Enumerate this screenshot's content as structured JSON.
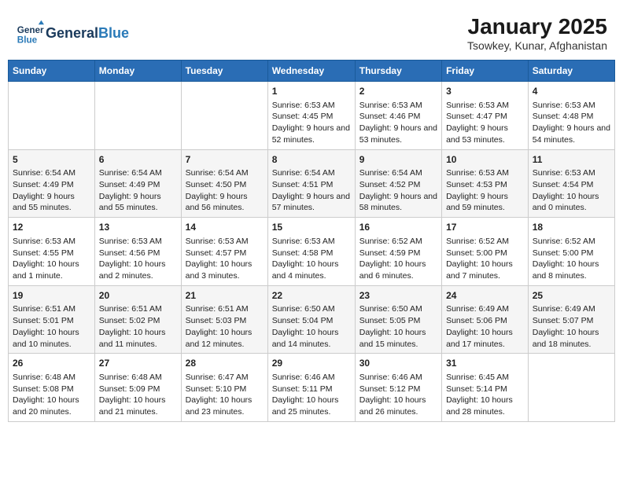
{
  "header": {
    "logo_general": "General",
    "logo_blue": "Blue",
    "title": "January 2025",
    "subtitle": "Tsowkey, Kunar, Afghanistan"
  },
  "days": [
    "Sunday",
    "Monday",
    "Tuesday",
    "Wednesday",
    "Thursday",
    "Friday",
    "Saturday"
  ],
  "weeks": [
    [
      {
        "date": "",
        "content": ""
      },
      {
        "date": "",
        "content": ""
      },
      {
        "date": "",
        "content": ""
      },
      {
        "date": "1",
        "content": "Sunrise: 6:53 AM\nSunset: 4:45 PM\nDaylight: 9 hours and 52 minutes."
      },
      {
        "date": "2",
        "content": "Sunrise: 6:53 AM\nSunset: 4:46 PM\nDaylight: 9 hours and 53 minutes."
      },
      {
        "date": "3",
        "content": "Sunrise: 6:53 AM\nSunset: 4:47 PM\nDaylight: 9 hours and 53 minutes."
      },
      {
        "date": "4",
        "content": "Sunrise: 6:53 AM\nSunset: 4:48 PM\nDaylight: 9 hours and 54 minutes."
      }
    ],
    [
      {
        "date": "5",
        "content": "Sunrise: 6:54 AM\nSunset: 4:49 PM\nDaylight: 9 hours and 55 minutes."
      },
      {
        "date": "6",
        "content": "Sunrise: 6:54 AM\nSunset: 4:49 PM\nDaylight: 9 hours and 55 minutes."
      },
      {
        "date": "7",
        "content": "Sunrise: 6:54 AM\nSunset: 4:50 PM\nDaylight: 9 hours and 56 minutes."
      },
      {
        "date": "8",
        "content": "Sunrise: 6:54 AM\nSunset: 4:51 PM\nDaylight: 9 hours and 57 minutes."
      },
      {
        "date": "9",
        "content": "Sunrise: 6:54 AM\nSunset: 4:52 PM\nDaylight: 9 hours and 58 minutes."
      },
      {
        "date": "10",
        "content": "Sunrise: 6:53 AM\nSunset: 4:53 PM\nDaylight: 9 hours and 59 minutes."
      },
      {
        "date": "11",
        "content": "Sunrise: 6:53 AM\nSunset: 4:54 PM\nDaylight: 10 hours and 0 minutes."
      }
    ],
    [
      {
        "date": "12",
        "content": "Sunrise: 6:53 AM\nSunset: 4:55 PM\nDaylight: 10 hours and 1 minute."
      },
      {
        "date": "13",
        "content": "Sunrise: 6:53 AM\nSunset: 4:56 PM\nDaylight: 10 hours and 2 minutes."
      },
      {
        "date": "14",
        "content": "Sunrise: 6:53 AM\nSunset: 4:57 PM\nDaylight: 10 hours and 3 minutes."
      },
      {
        "date": "15",
        "content": "Sunrise: 6:53 AM\nSunset: 4:58 PM\nDaylight: 10 hours and 4 minutes."
      },
      {
        "date": "16",
        "content": "Sunrise: 6:52 AM\nSunset: 4:59 PM\nDaylight: 10 hours and 6 minutes."
      },
      {
        "date": "17",
        "content": "Sunrise: 6:52 AM\nSunset: 5:00 PM\nDaylight: 10 hours and 7 minutes."
      },
      {
        "date": "18",
        "content": "Sunrise: 6:52 AM\nSunset: 5:00 PM\nDaylight: 10 hours and 8 minutes."
      }
    ],
    [
      {
        "date": "19",
        "content": "Sunrise: 6:51 AM\nSunset: 5:01 PM\nDaylight: 10 hours and 10 minutes."
      },
      {
        "date": "20",
        "content": "Sunrise: 6:51 AM\nSunset: 5:02 PM\nDaylight: 10 hours and 11 minutes."
      },
      {
        "date": "21",
        "content": "Sunrise: 6:51 AM\nSunset: 5:03 PM\nDaylight: 10 hours and 12 minutes."
      },
      {
        "date": "22",
        "content": "Sunrise: 6:50 AM\nSunset: 5:04 PM\nDaylight: 10 hours and 14 minutes."
      },
      {
        "date": "23",
        "content": "Sunrise: 6:50 AM\nSunset: 5:05 PM\nDaylight: 10 hours and 15 minutes."
      },
      {
        "date": "24",
        "content": "Sunrise: 6:49 AM\nSunset: 5:06 PM\nDaylight: 10 hours and 17 minutes."
      },
      {
        "date": "25",
        "content": "Sunrise: 6:49 AM\nSunset: 5:07 PM\nDaylight: 10 hours and 18 minutes."
      }
    ],
    [
      {
        "date": "26",
        "content": "Sunrise: 6:48 AM\nSunset: 5:08 PM\nDaylight: 10 hours and 20 minutes."
      },
      {
        "date": "27",
        "content": "Sunrise: 6:48 AM\nSunset: 5:09 PM\nDaylight: 10 hours and 21 minutes."
      },
      {
        "date": "28",
        "content": "Sunrise: 6:47 AM\nSunset: 5:10 PM\nDaylight: 10 hours and 23 minutes."
      },
      {
        "date": "29",
        "content": "Sunrise: 6:46 AM\nSunset: 5:11 PM\nDaylight: 10 hours and 25 minutes."
      },
      {
        "date": "30",
        "content": "Sunrise: 6:46 AM\nSunset: 5:12 PM\nDaylight: 10 hours and 26 minutes."
      },
      {
        "date": "31",
        "content": "Sunrise: 6:45 AM\nSunset: 5:14 PM\nDaylight: 10 hours and 28 minutes."
      },
      {
        "date": "",
        "content": ""
      }
    ]
  ]
}
